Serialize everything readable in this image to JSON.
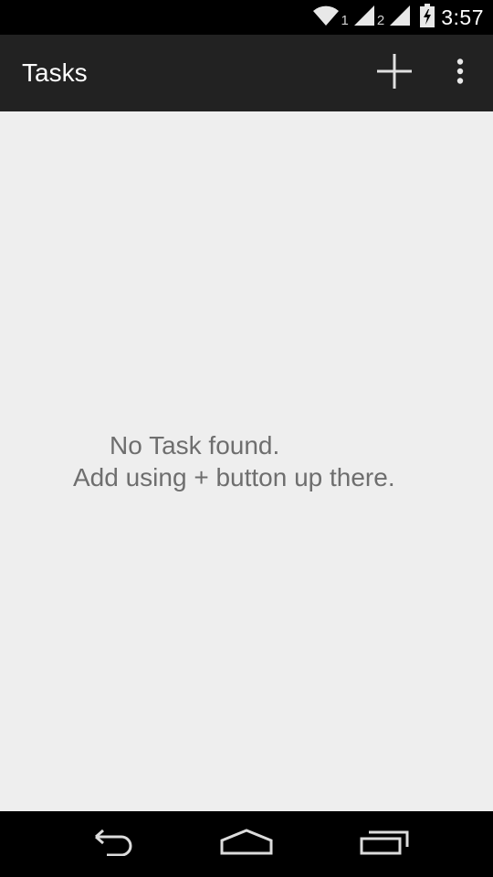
{
  "status_bar": {
    "sim1_label": "1",
    "sim2_label": "2",
    "time": "3:57",
    "icons": [
      "wifi-icon",
      "signal-icon",
      "signal-icon",
      "battery-charging-icon"
    ]
  },
  "action_bar": {
    "title": "Tasks",
    "actions": [
      "add-icon",
      "overflow-menu-icon"
    ],
    "background_color": "#222222"
  },
  "content": {
    "empty_line1": "No Task found.",
    "empty_line2": "Add using + button up there.",
    "background_color": "#eeeeee",
    "text_color": "#6e6e6e"
  },
  "nav_bar": {
    "buttons": [
      "back-icon",
      "home-icon",
      "recent-apps-icon"
    ]
  }
}
